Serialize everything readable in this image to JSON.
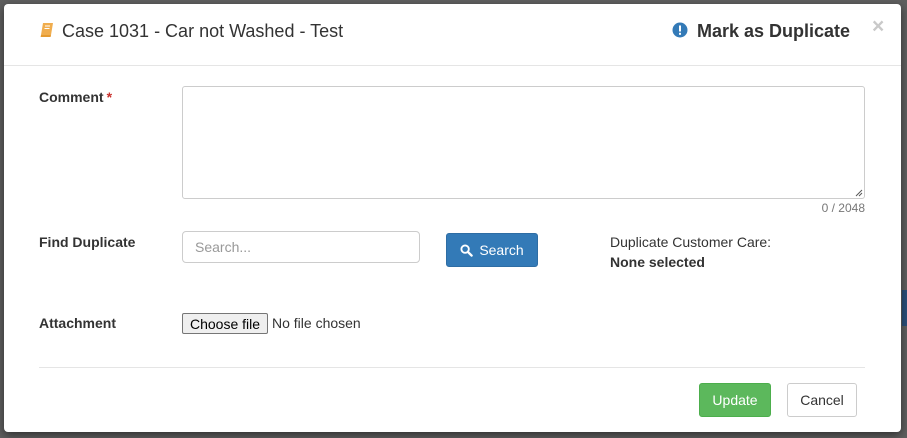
{
  "modal": {
    "case_title": "Case 1031 - Car not Washed - Test",
    "action_title": "Mark as Duplicate",
    "close_label": "×",
    "icons": {
      "case": "book-icon",
      "action": "exclamation-circle-icon",
      "search": "search-icon"
    }
  },
  "form": {
    "comment": {
      "label": "Comment",
      "required_mark": "*",
      "value": "",
      "counter": "0 / 2048"
    },
    "find_duplicate": {
      "label": "Find Duplicate",
      "placeholder": "Search...",
      "search_button": "Search",
      "result_label": "Duplicate Customer Care:",
      "result_value": "None selected"
    },
    "attachment": {
      "label": "Attachment",
      "button": "Choose file",
      "status": "No file chosen"
    }
  },
  "footer": {
    "update_label": "Update",
    "cancel_label": "Cancel"
  },
  "colors": {
    "primary": "#337ab7",
    "success": "#5cb85c",
    "book_icon": "#f0ad4e",
    "action_icon": "#337ab7"
  }
}
